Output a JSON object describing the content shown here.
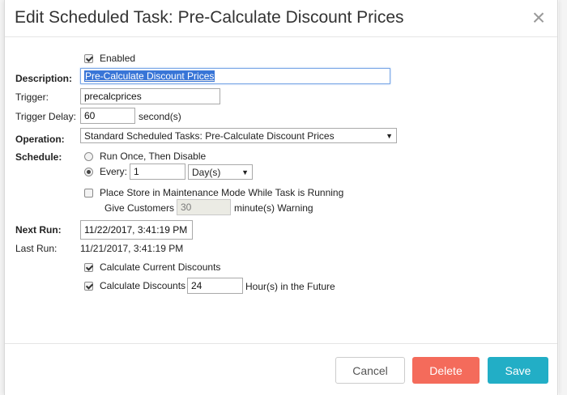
{
  "modal": {
    "title": "Edit Scheduled Task: Pre-Calculate Discount Prices",
    "close_symbol": "×"
  },
  "form": {
    "enabled": {
      "label": "Enabled",
      "checked": true
    },
    "description": {
      "label": "Description:",
      "value": "Pre-Calculate Discount Prices"
    },
    "trigger": {
      "label": "Trigger:",
      "value": "precalcprices"
    },
    "trigger_delay": {
      "label": "Trigger Delay:",
      "value": "60",
      "unit": "second(s)"
    },
    "operation": {
      "label": "Operation:",
      "selected": "Standard Scheduled Tasks: Pre-Calculate Discount Prices"
    },
    "schedule": {
      "label": "Schedule:",
      "run_once_label": "Run Once, Then Disable",
      "every_label": "Every:",
      "every_value": "1",
      "every_unit": "Day(s)",
      "selected_option": "every"
    },
    "maintenance": {
      "label": "Place Store in Maintenance Mode While Task is Running",
      "checked": false,
      "give_label": "Give Customers",
      "give_value": "30",
      "warning_label": "minute(s) Warning"
    },
    "next_run": {
      "label": "Next Run:",
      "value": "11/22/2017, 3:41:19 PM"
    },
    "last_run": {
      "label": "Last Run:",
      "value": "11/21/2017, 3:41:19 PM"
    },
    "calc_current": {
      "label": "Calculate Current Discounts",
      "checked": true
    },
    "calc_future": {
      "label": "Calculate Discounts",
      "value": "24",
      "unit": "Hour(s) in the Future",
      "checked": true
    }
  },
  "footer": {
    "cancel_label": "Cancel",
    "delete_label": "Delete",
    "save_label": "Save"
  },
  "colors": {
    "delete": "#f46b5b",
    "save": "#22aec6",
    "selection": "#3875d7"
  }
}
